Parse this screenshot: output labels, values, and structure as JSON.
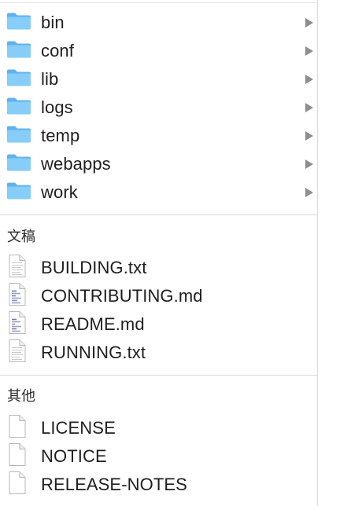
{
  "folders": [
    {
      "label": "bin",
      "icon": "folder-icon"
    },
    {
      "label": "conf",
      "icon": "folder-icon"
    },
    {
      "label": "lib",
      "icon": "folder-icon"
    },
    {
      "label": "logs",
      "icon": "folder-icon"
    },
    {
      "label": "temp",
      "icon": "folder-icon"
    },
    {
      "label": "webapps",
      "icon": "folder-icon"
    },
    {
      "label": "work",
      "icon": "folder-icon"
    }
  ],
  "documents": {
    "title": "文稿",
    "items": [
      {
        "label": "BUILDING.txt",
        "icon": "text-document-icon"
      },
      {
        "label": "CONTRIBUTING.md",
        "icon": "markdown-document-icon"
      },
      {
        "label": "README.md",
        "icon": "markdown-document-icon"
      },
      {
        "label": "RUNNING.txt",
        "icon": "text-document-icon"
      }
    ]
  },
  "other": {
    "title": "其他",
    "items": [
      {
        "label": "LICENSE",
        "icon": "blank-file-icon"
      },
      {
        "label": "NOTICE",
        "icon": "blank-file-icon"
      },
      {
        "label": "RELEASE-NOTES",
        "icon": "blank-file-icon"
      }
    ]
  },
  "colors": {
    "folder_fill": "#7cc6f6",
    "folder_tab": "#5fb3ee",
    "arrow": "#8e8e8e",
    "separator": "#d9d9d9"
  }
}
